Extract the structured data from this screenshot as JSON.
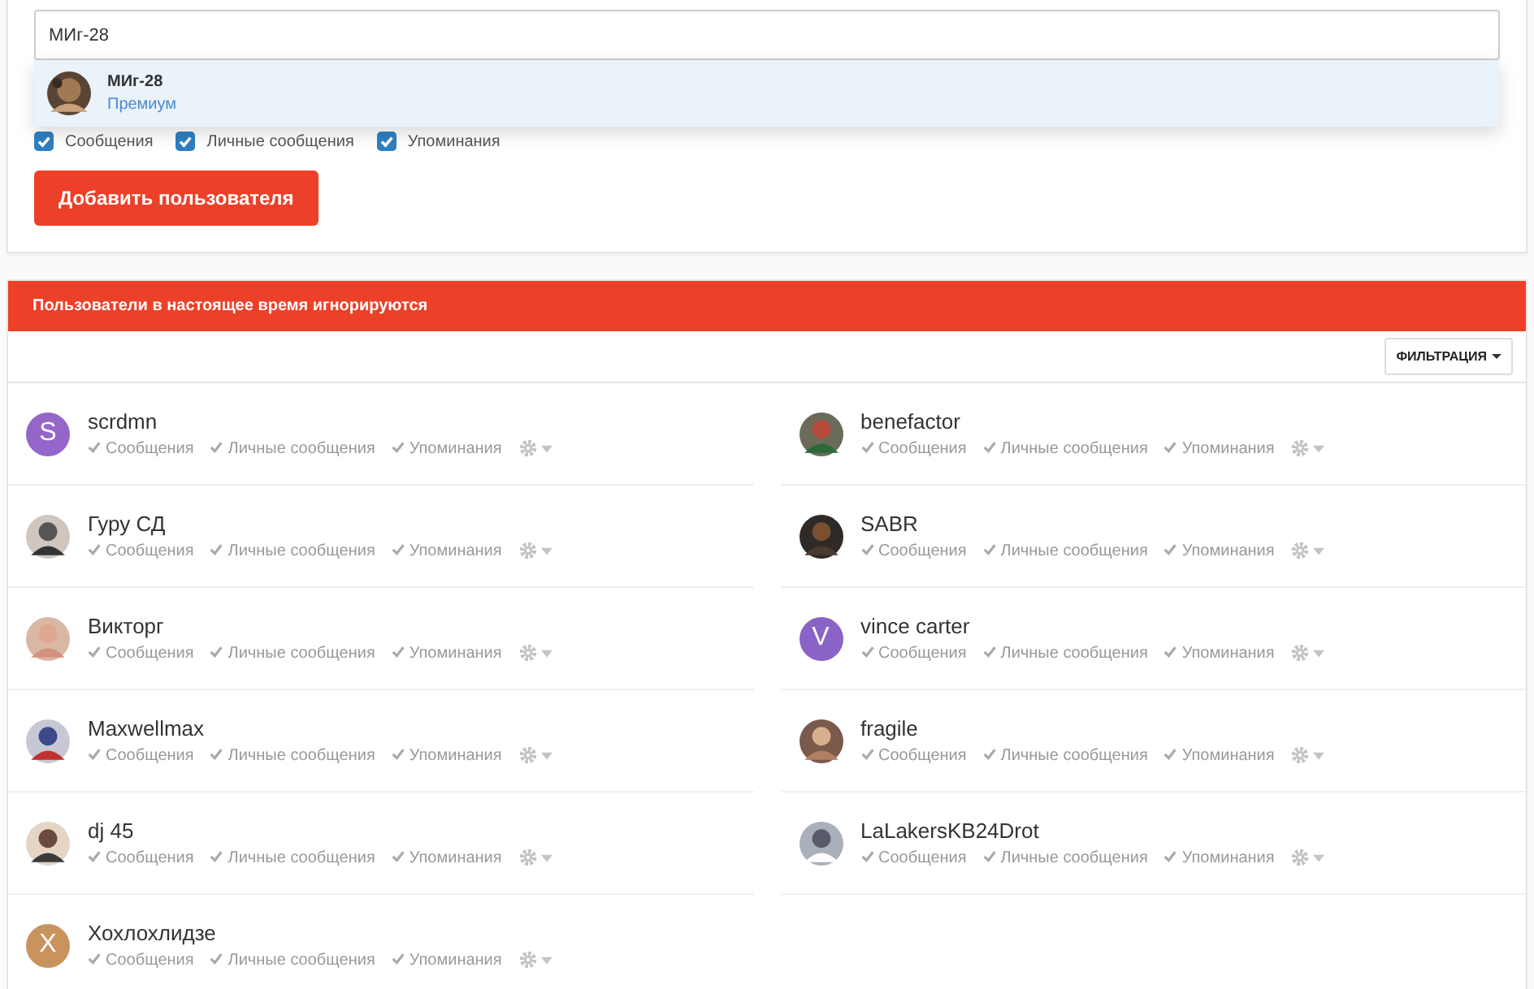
{
  "search": {
    "value": "МИг-28"
  },
  "suggestions": [
    {
      "name": "МИг-28",
      "group": "Премиум",
      "selected": true
    }
  ],
  "options": [
    {
      "label": "Сообщения",
      "checked": true
    },
    {
      "label": "Личные сообщения",
      "checked": true
    },
    {
      "label": "Упоминания",
      "checked": true
    }
  ],
  "add_button": "Добавить пользователя",
  "panel": {
    "title": "Пользователи в настоящее время игнорируются",
    "filter_button": "ФИЛЬТРАЦИЯ"
  },
  "users": [
    {
      "name": "scrdmn",
      "avatar": {
        "kind": "letter",
        "letter": "S",
        "color": "#9566c9"
      },
      "options": [
        "Сообщения",
        "Личные сообщения",
        "Упоминания"
      ]
    },
    {
      "name": "benefactor",
      "options": [
        "Сообщения",
        "Личные сообщения",
        "Упоминания"
      ]
    },
    {
      "name": "Гуру СД",
      "options": [
        "Сообщения",
        "Личные сообщения",
        "Упоминания"
      ]
    },
    {
      "name": "SABR",
      "options": [
        "Сообщения",
        "Личные сообщения",
        "Упоминания"
      ]
    },
    {
      "name": "Викторг",
      "options": [
        "Сообщения",
        "Личные сообщения",
        "Упоминания"
      ]
    },
    {
      "name": "vince carter",
      "avatar": {
        "kind": "letter",
        "letter": "V",
        "color": "#8a63c6"
      },
      "options": [
        "Сообщения",
        "Личные сообщения",
        "Упоминания"
      ]
    },
    {
      "name": "Maxwellmax",
      "options": [
        "Сообщения",
        "Личные сообщения",
        "Упоминания"
      ]
    },
    {
      "name": "fragile",
      "options": [
        "Сообщения",
        "Личные сообщения",
        "Упоминания"
      ]
    },
    {
      "name": "dj 45",
      "options": [
        "Сообщения",
        "Личные сообщения",
        "Упоминания"
      ]
    },
    {
      "name": "LaLakersKB24Drot",
      "options": [
        "Сообщения",
        "Личные сообщения",
        "Упоминания"
      ]
    },
    {
      "name": "Хохлохлидзе",
      "avatar": {
        "kind": "letter",
        "letter": "X",
        "color": "#c9935e"
      },
      "options": [
        "Сообщения",
        "Личные сообщения",
        "Упоминания"
      ]
    }
  ]
}
